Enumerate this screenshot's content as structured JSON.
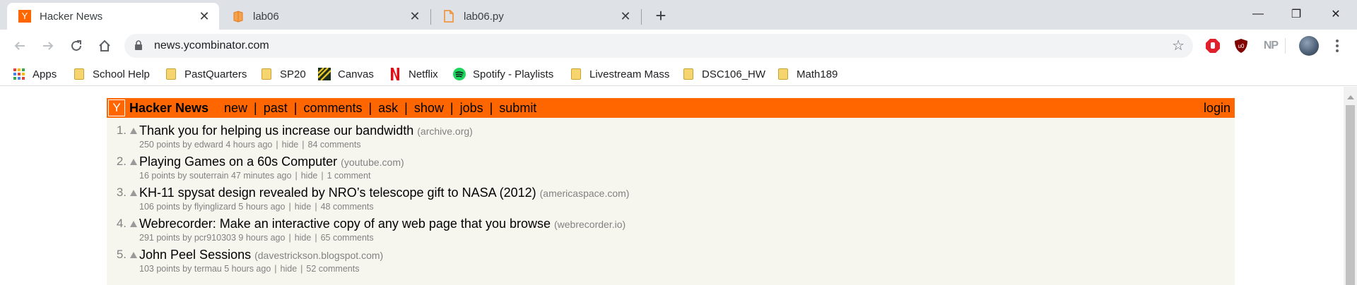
{
  "browser": {
    "tabs": [
      {
        "title": "Hacker News",
        "favicon": "Y",
        "active": true
      },
      {
        "title": "lab06",
        "favicon": "notebook-icon",
        "active": false
      },
      {
        "title": "lab06.py",
        "favicon": "file-icon",
        "active": false
      }
    ],
    "tab_close_glyph": "✕",
    "new_tab_glyph": "+",
    "window_controls": {
      "minimize": "—",
      "maximize": "❐",
      "close": "✕"
    },
    "url": "news.ycombinator.com",
    "extensions": {
      "np": "NP"
    }
  },
  "bookmarks": [
    {
      "label": "Apps",
      "icon": "apps-grid-icon"
    },
    {
      "label": "School Help",
      "icon": "folder-icon"
    },
    {
      "label": "PastQuarters",
      "icon": "folder-icon"
    },
    {
      "label": "SP20",
      "icon": "folder-icon"
    },
    {
      "label": "Canvas",
      "icon": "canvas-icon"
    },
    {
      "label": "Netflix",
      "icon": "netflix-icon"
    },
    {
      "label": "Spotify - Playlists",
      "icon": "spotify-icon"
    },
    {
      "label": "Livestream Mass",
      "icon": "folder-icon"
    },
    {
      "label": "DSC106_HW",
      "icon": "folder-icon"
    },
    {
      "label": "Math189",
      "icon": "folder-icon"
    }
  ],
  "hn": {
    "logo": "Y",
    "site_name": "Hacker News",
    "nav": [
      "new",
      "past",
      "comments",
      "ask",
      "show",
      "jobs",
      "submit"
    ],
    "separator": "|",
    "login": "login",
    "accent": "#ff6600",
    "background": "#f6f6ef",
    "stories": [
      {
        "rank": "1.",
        "title": "Thank you for helping us increase our bandwidth",
        "site": "(archive.org)",
        "points": "250 points",
        "by": "by",
        "user": "edward",
        "age": "4 hours ago",
        "hide": "hide",
        "comments": "84 comments"
      },
      {
        "rank": "2.",
        "title": "Playing Games on a 60s Computer",
        "site": "(youtube.com)",
        "points": "16 points",
        "by": "by",
        "user": "souterrain",
        "age": "47 minutes ago",
        "hide": "hide",
        "comments": "1 comment"
      },
      {
        "rank": "3.",
        "title": "KH-11 spysat design revealed by NRO’s telescope gift to NASA (2012)",
        "site": "(americaspace.com)",
        "points": "106 points",
        "by": "by",
        "user": "flyinglizard",
        "age": "5 hours ago",
        "hide": "hide",
        "comments": "48 comments"
      },
      {
        "rank": "4.",
        "title": "Webrecorder: Make an interactive copy of any web page that you browse",
        "site": "(webrecorder.io)",
        "points": "291 points",
        "by": "by",
        "user": "pcr910303",
        "age": "9 hours ago",
        "hide": "hide",
        "comments": "65 comments"
      },
      {
        "rank": "5.",
        "title": "John Peel Sessions",
        "site": "(davestrickson.blogspot.com)",
        "points": "103 points",
        "by": "by",
        "user": "termau",
        "age": "5 hours ago",
        "hide": "hide",
        "comments": "52 comments"
      }
    ]
  }
}
